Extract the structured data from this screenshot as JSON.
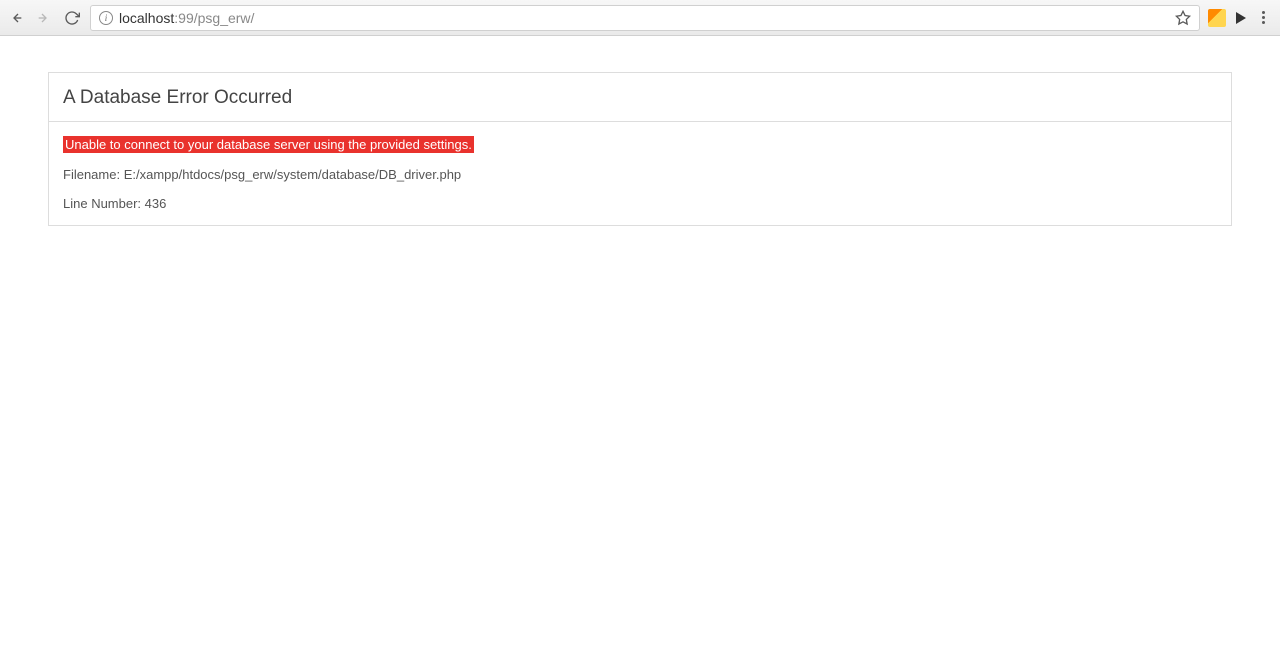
{
  "browser": {
    "url_host": "localhost",
    "url_port_path": ":99/psg_erw/"
  },
  "error": {
    "title": "A Database Error Occurred",
    "message": "Unable to connect to your database server using the provided settings.",
    "filename_label": "Filename: ",
    "filename_value": "E:/xampp/htdocs/psg_erw/system/database/DB_driver.php",
    "line_label": "Line Number: ",
    "line_value": "436"
  }
}
